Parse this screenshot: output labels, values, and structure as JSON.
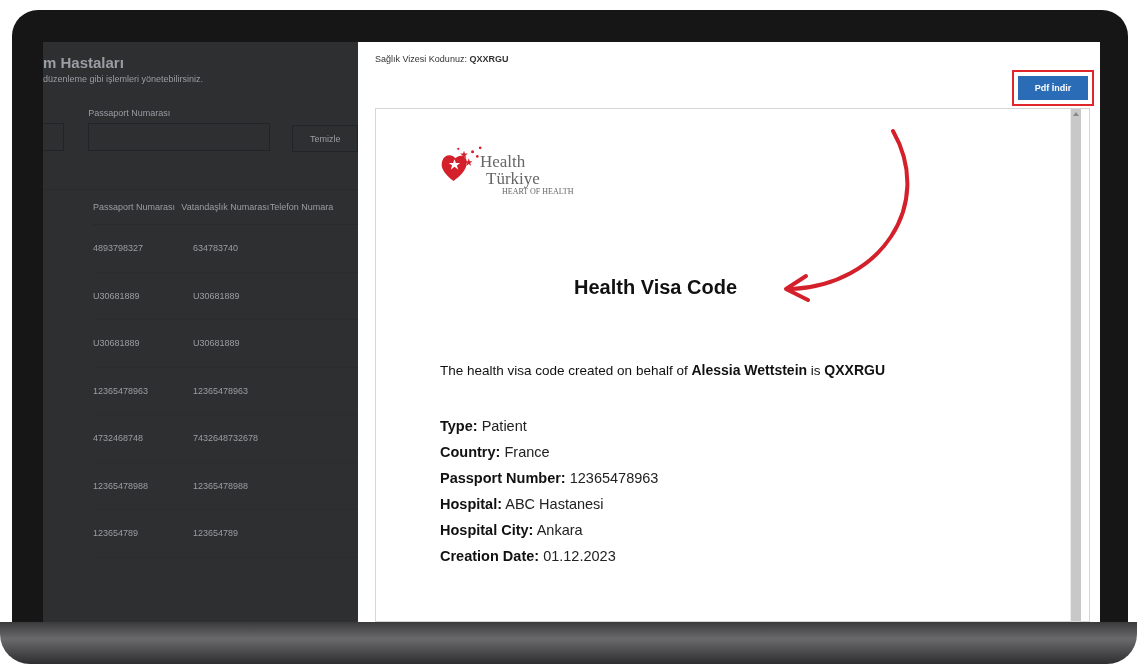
{
  "background_page": {
    "title": "m Hastaları",
    "subtitle": "düzenleme gibi işlemleri yönetebilirsiniz.",
    "filter_label": "Passaport Numarası",
    "clear_button": "Temizle",
    "table": {
      "columns": [
        "Passaport Numarası",
        "Vatandaşlık Numarası",
        "Telefon Numara"
      ],
      "rows": [
        [
          "4893798327",
          "634783740"
        ],
        [
          "U30681889",
          "U30681889"
        ],
        [
          "U30681889",
          "U30681889"
        ],
        [
          "12365478963",
          "12365478963"
        ],
        [
          "4732468748",
          "7432648732678"
        ],
        [
          "12365478988",
          "12365478988"
        ],
        [
          "123654789",
          "123654789"
        ]
      ]
    }
  },
  "modal": {
    "code_label": "Sağlık Vizesi Kodunuz:",
    "code": "QXXRGU",
    "pdf_button": "Pdf İndir",
    "document": {
      "logo": {
        "line1": "Health",
        "line2": "Türkiye",
        "tagline": "HEART OF HEALTH"
      },
      "heading": "Health Visa Code",
      "sentence": "The health visa code created on behalf of  **Alessia Wettstein** is **QXXRGU**",
      "fields": [
        {
          "label": "Type:",
          "value": "Patient"
        },
        {
          "label": "Country:",
          "value": "France"
        },
        {
          "label": "Passport Number:",
          "value": "12365478963"
        },
        {
          "label": "Hospital:",
          "value": "ABC Hastanesi"
        },
        {
          "label": "Hospital City:",
          "value": "Ankara"
        },
        {
          "label": "Creation Date:",
          "value": "01.12.2023"
        }
      ]
    }
  }
}
